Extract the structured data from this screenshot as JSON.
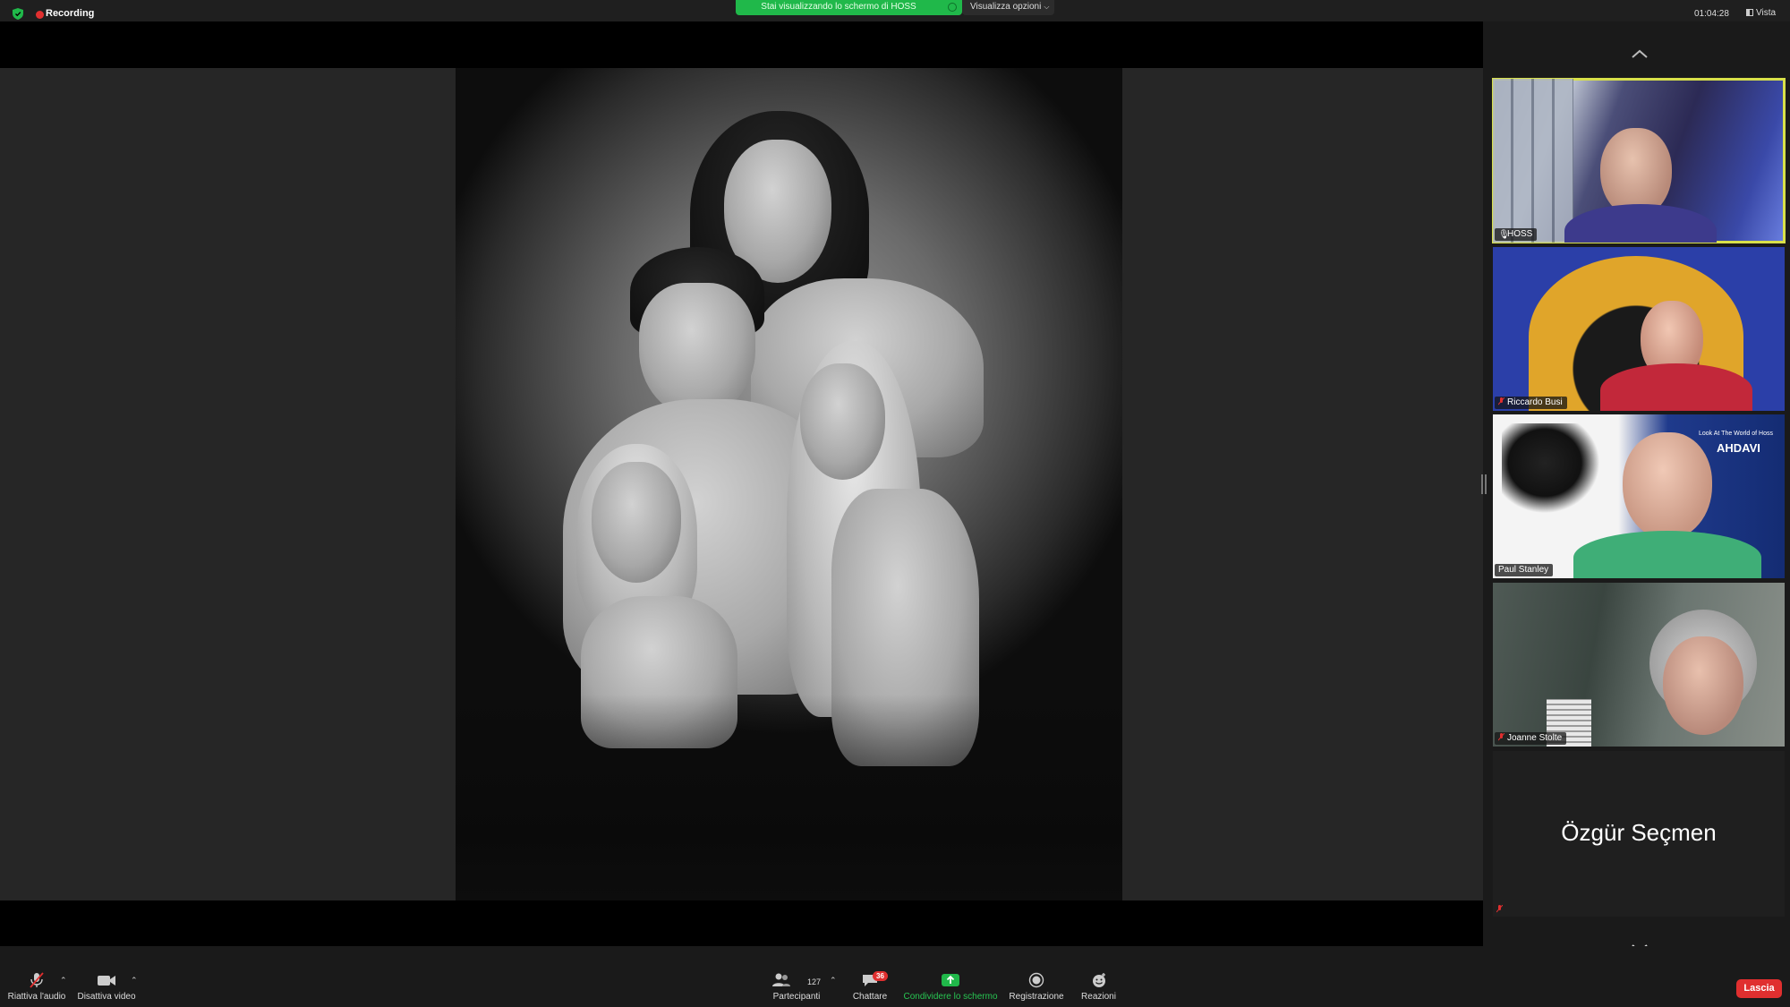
{
  "topbar": {
    "recording_label": "Recording",
    "share_banner_text": "Stai visualizzando lo schermo di HOSS",
    "view_options_label": "Visualizza opzioni",
    "timer": "01:04:28",
    "view_label": "Vista"
  },
  "participants": [
    {
      "name": "HOSS",
      "active_speaker": true,
      "muted": false
    },
    {
      "name": "Riccardo Busi",
      "active_speaker": false,
      "muted": true
    },
    {
      "name": "Paul Stanley",
      "active_speaker": false,
      "muted": false
    },
    {
      "name": "Joanne Stolte",
      "active_speaker": false,
      "muted": true
    },
    {
      "name": "Özgür Seçmen",
      "active_speaker": false,
      "muted": true,
      "video_off": true
    }
  ],
  "tile_texts": {
    "tile3_banner": "Look At The World of Hoss",
    "tile3_title": "AHDAVI"
  },
  "toolbar": {
    "audio_label": "Riattiva l'audio",
    "video_label": "Disattiva video",
    "participants_label": "Partecipanti",
    "participants_count": "127",
    "chat_label": "Chattare",
    "chat_badge": "36",
    "share_label": "Condividere lo schermo",
    "record_label": "Registrazione",
    "reactions_label": "Reazioni",
    "leave_label": "Lascia"
  },
  "colors": {
    "share_green": "#20b84a",
    "recording_red": "#e02f2f",
    "active_speaker_border": "#d8e04a",
    "leave_red": "#e02f2f"
  }
}
